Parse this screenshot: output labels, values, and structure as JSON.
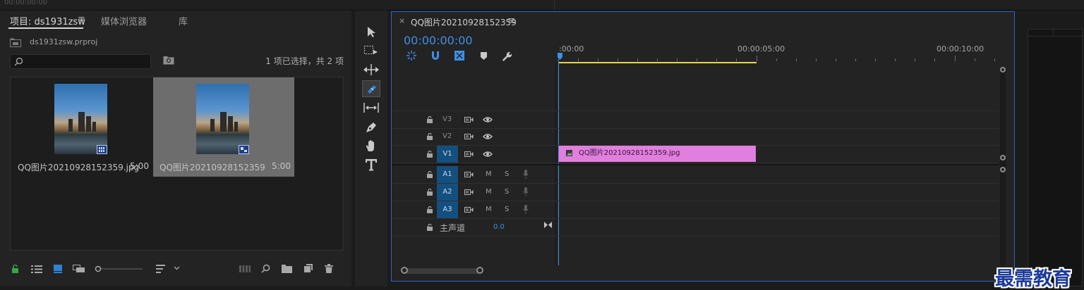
{
  "top_strip": {
    "timecode": "00:00:00:00"
  },
  "project_panel": {
    "tabs": [
      {
        "label": "项目: ds1931zsw"
      },
      {
        "label": "媒体浏览器"
      },
      {
        "label": "库"
      }
    ],
    "project_file": "ds1931zsw.prproj",
    "search_placeholder": "",
    "selection_status": "1 项已选择，共 2 项",
    "items": [
      {
        "name": "QQ图片20210928152359.jpg",
        "duration": "5:00"
      },
      {
        "name": "QQ图片20210928152359",
        "duration": "5:00"
      }
    ]
  },
  "timeline": {
    "sequence_tab": "QQ图片20210928152359",
    "timecode": "00:00:00:00",
    "ruler_labels": [
      ":00:00",
      "00:00:05:00",
      "00:00:10:00"
    ],
    "video_tracks": [
      "V3",
      "V2",
      "V1"
    ],
    "audio_tracks": [
      "A1",
      "A2",
      "A3"
    ],
    "mute_label": "M",
    "solo_label": "S",
    "master": {
      "label": "主声道",
      "value": "0.0"
    },
    "clip": {
      "name": "QQ图片20210928152359.jpg",
      "color": "#e07fde"
    }
  },
  "colors": {
    "accent": "#3d8fe8",
    "selection": "#14507f",
    "work_area": "#e5d84a"
  },
  "watermark": "最需教育"
}
